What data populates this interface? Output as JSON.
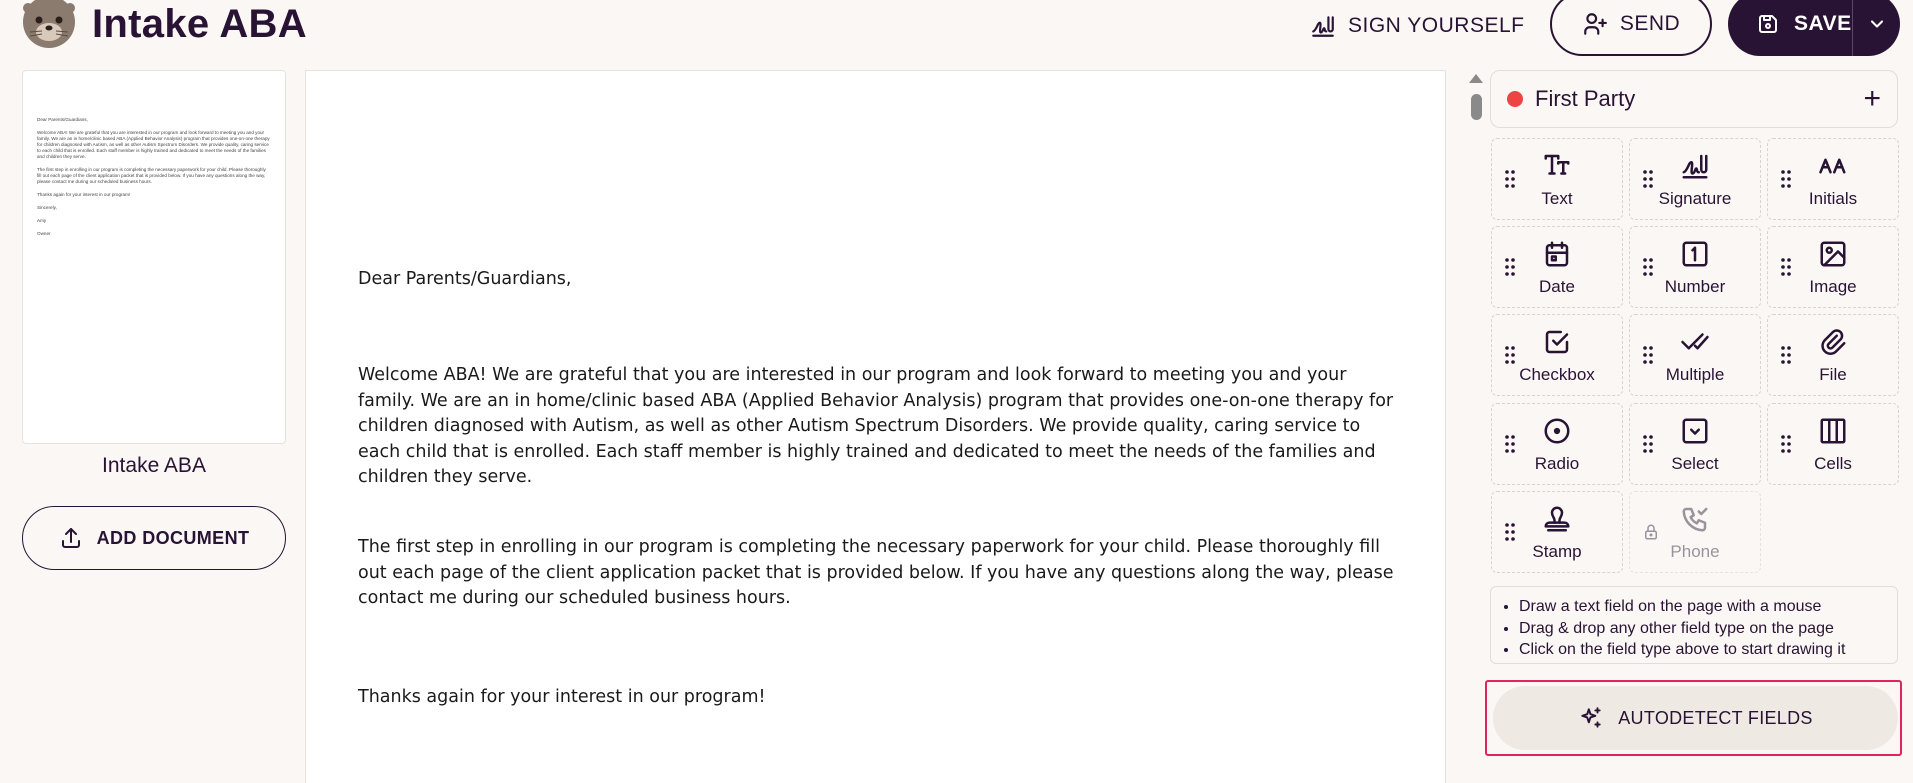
{
  "header": {
    "title": "Intake ABA",
    "sign_yourself_label": "SIGN YOURSELF",
    "send_label": "SEND",
    "save_label": "SAVE"
  },
  "sidebar": {
    "document_name": "Intake ABA",
    "add_document_label": "ADD DOCUMENT",
    "thumbnail_lines": [
      "Dear Parents/Guardians,",
      "Welcome ABA! We are grateful that you are interested in our program and look forward to meeting you and your family. We are an in home/clinic based ABA (Applied Behavior Analysis) program that provides one-on-one therapy for children diagnosed with Autism, as well as other Autism Spectrum Disorders. We provide quality, caring service to each child that is enrolled. Each staff member is highly trained and dedicated to meet the needs of the families and children they serve.",
      "The first step in enrolling in our program is completing the necessary paperwork for your child. Please thoroughly fill out each page of the client application packet that is provided below. If you have any questions along the way, please contact me during our scheduled business hours.",
      "Thanks again for your interest in our program!",
      "Sincerely,",
      "Amy",
      "Owner"
    ]
  },
  "document": {
    "greeting": "Dear Parents/Guardians,",
    "paragraph1": "Welcome ABA! We are grateful that you are interested in our program and look forward to meeting you and your family. We are an in home/clinic based ABA (Applied Behavior Analysis) program that provides one-on-one therapy for children diagnosed with Autism, as well as other Autism Spectrum Disorders. We provide quality, caring service to each child that is enrolled. Each staff member is highly trained and dedicated to meet the needs of the families and children they serve.",
    "paragraph2": "The first step in enrolling in our program is completing the necessary paperwork for your child. Please thoroughly fill out each page of the client application packet that is provided below. If you have any questions along the way, please contact me during our scheduled business hours.",
    "paragraph3": "Thanks again for your interest in our program!"
  },
  "panel": {
    "party_name": "First Party",
    "party_color": "#ef4444",
    "fields": [
      {
        "label": "Text",
        "icon": "text-icon"
      },
      {
        "label": "Signature",
        "icon": "signature-icon"
      },
      {
        "label": "Initials",
        "icon": "initials-icon"
      },
      {
        "label": "Date",
        "icon": "calendar-icon"
      },
      {
        "label": "Number",
        "icon": "number-icon"
      },
      {
        "label": "Image",
        "icon": "image-icon"
      },
      {
        "label": "Checkbox",
        "icon": "checkbox-icon"
      },
      {
        "label": "Multiple",
        "icon": "double-check-icon"
      },
      {
        "label": "File",
        "icon": "paperclip-icon"
      },
      {
        "label": "Radio",
        "icon": "radio-icon"
      },
      {
        "label": "Select",
        "icon": "select-icon"
      },
      {
        "label": "Cells",
        "icon": "columns-icon"
      },
      {
        "label": "Stamp",
        "icon": "stamp-icon"
      },
      {
        "label": "Phone",
        "icon": "phone-icon",
        "locked": true
      }
    ],
    "hints": [
      "Draw a text field on the page with a mouse",
      "Drag & drop any other field type on the page",
      "Click on the field type above to start drawing it"
    ],
    "autodetect_label": "AUTODETECT FIELDS",
    "highlight_color": "#e0245e"
  }
}
